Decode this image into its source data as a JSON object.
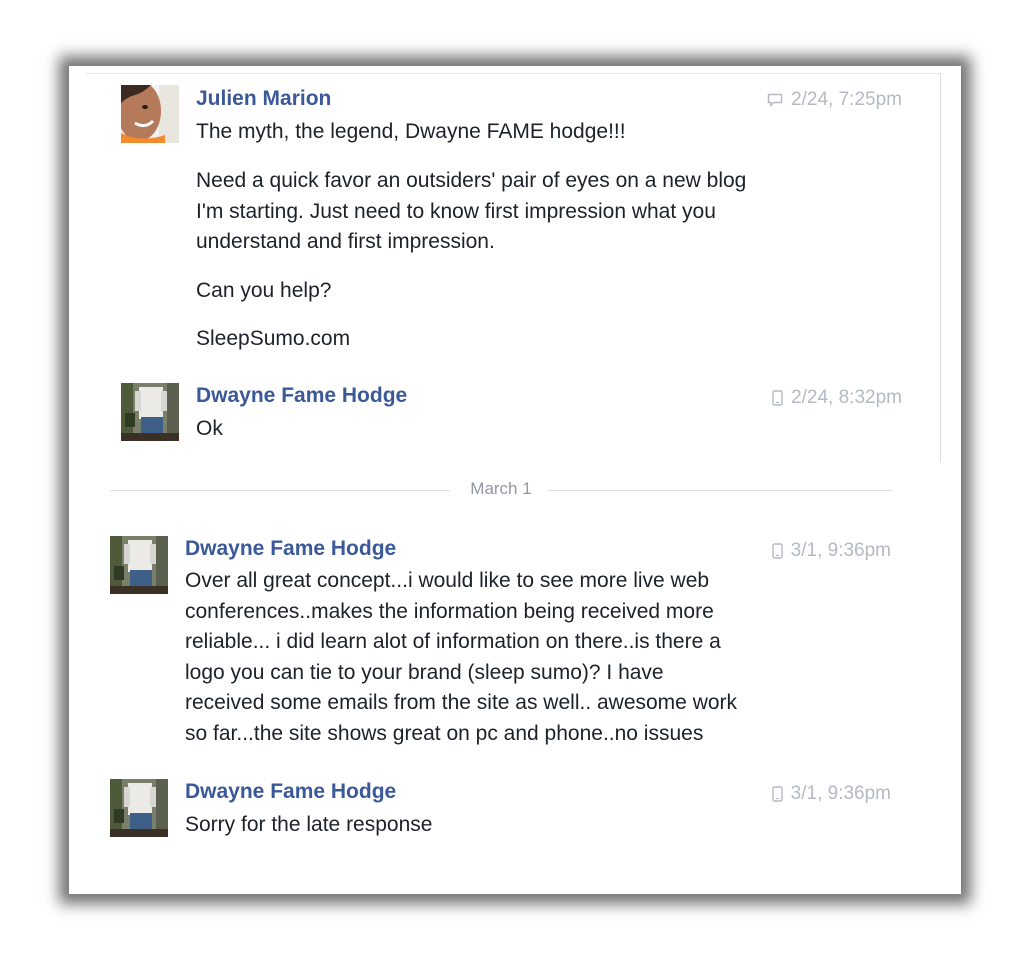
{
  "thread": {
    "date_divider": "March 1",
    "messages": [
      {
        "sender": "Julien Marion",
        "timestamp": "2/24, 7:25pm",
        "source_icon": "chat-bubble-icon",
        "paragraphs": [
          "The myth, the legend, Dwayne FAME hodge!!!",
          "Need a quick favor an outsiders' pair of eyes on a new blog\nI'm starting. Just need to know first impression what you\nunderstand and first impression.",
          "Can you help?",
          "SleepSumo.com"
        ]
      },
      {
        "sender": "Dwayne Fame Hodge",
        "timestamp": "2/24, 8:32pm",
        "source_icon": "mobile-phone-icon",
        "paragraphs": [
          "Ok"
        ]
      },
      {
        "sender": "Dwayne Fame Hodge",
        "timestamp": "3/1, 9:36pm",
        "source_icon": "mobile-phone-icon",
        "paragraphs": [
          "Over all great concept...i would like to see more live web\nconferences..makes the information being received more\nreliable... i did learn alot of information on there..is there a\nlogo you can tie to your brand (sleep sumo)? I have\nreceived some emails from the site as well.. awesome work\nso far...the site shows great on pc and phone..no issues"
        ]
      },
      {
        "sender": "Dwayne Fame Hodge",
        "timestamp": "3/1, 9:36pm",
        "source_icon": "mobile-phone-icon",
        "paragraphs": [
          "Sorry for the late response"
        ]
      }
    ]
  },
  "colors": {
    "sender_name": "#3b5998",
    "message_text": "#1d2129",
    "timestamp": "#b4b9c3",
    "divider_text": "#9197a3"
  }
}
